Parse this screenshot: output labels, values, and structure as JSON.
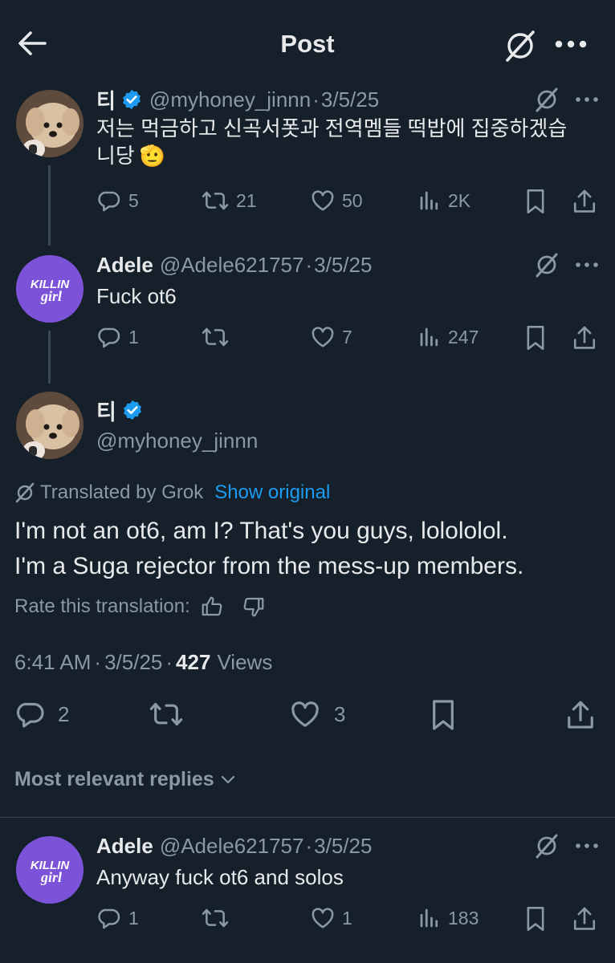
{
  "header": {
    "title": "Post",
    "back_icon": "arrow-left-icon",
    "grok_icon": "grok-icon",
    "more_icon": "more-icon"
  },
  "tweet1": {
    "display_name": "티",
    "handle": "@myhoney_jinnn",
    "separator": "·",
    "date": "3/5/25",
    "text_line1": "저는 먹금하고 신곡서폿과 전역멤들 떡밥에 집중하겠습",
    "text_line2": "니당",
    "emoji": "🫡",
    "replies": "5",
    "reposts": "21",
    "likes": "50",
    "views": "2K"
  },
  "tweet2": {
    "display_name": "Adele",
    "handle": "@Adele621757",
    "separator": "·",
    "date": "3/5/25",
    "text": "Fuck ot6",
    "replies": "1",
    "reposts": "",
    "likes": "7",
    "views": "247",
    "avatar_text_top": "KILLIN",
    "avatar_text_bottom": "girl"
  },
  "main": {
    "display_name": "티",
    "handle": "@myhoney_jinnn",
    "translated_label": "Translated by Grok",
    "show_original": "Show original",
    "text_line1": "I'm not an ot6, am I? That's you guys, lolololol.",
    "text_line2": "I'm a Suga rejector from the mess-up members.",
    "rate_label": "Rate this translation:",
    "time": "6:41 AM",
    "sep1": "·",
    "date": "3/5/25",
    "sep2": "·",
    "views_count": "427",
    "views_label": "Views",
    "replies": "2",
    "reposts": "",
    "likes": "3"
  },
  "replies_section": {
    "label": "Most relevant replies"
  },
  "reply1": {
    "display_name": "Adele",
    "handle": "@Adele621757",
    "separator": "·",
    "date": "3/5/25",
    "text": "Anyway fuck ot6 and solos",
    "replies": "1",
    "reposts": "",
    "likes": "1",
    "views": "183",
    "avatar_text_top": "KILLIN",
    "avatar_text_bottom": "girl"
  },
  "colors": {
    "background": "#15202b",
    "text": "#e7e9ea",
    "secondary": "#8b98a5",
    "accent": "#1d9bf0",
    "verified": "#1d9bf0",
    "adele_avatar": "#7c53d8"
  }
}
